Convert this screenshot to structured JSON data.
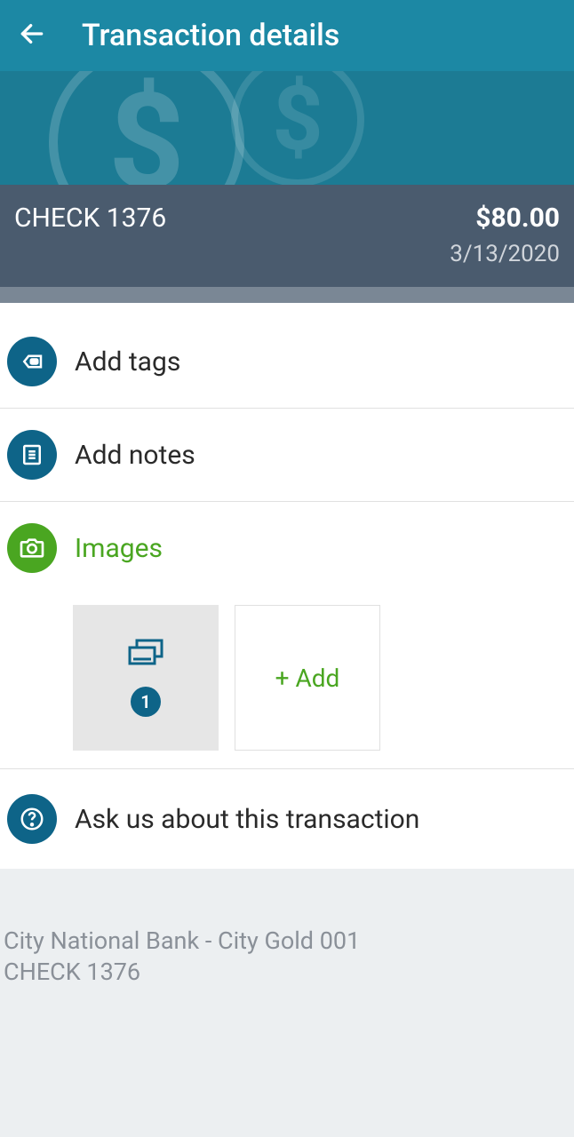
{
  "header": {
    "title": "Transaction details"
  },
  "transaction": {
    "name": "CHECK 1376",
    "amount": "$80.00",
    "date": "3/13/2020"
  },
  "actions": {
    "add_tags": "Add tags",
    "add_notes": "Add notes",
    "images_label": "Images",
    "image_count": "1",
    "add_image": "+ Add",
    "ask_label": "Ask us about this transaction"
  },
  "footer": {
    "account_line": "City National Bank - City Gold 001",
    "check_line": "CHECK 1376"
  }
}
